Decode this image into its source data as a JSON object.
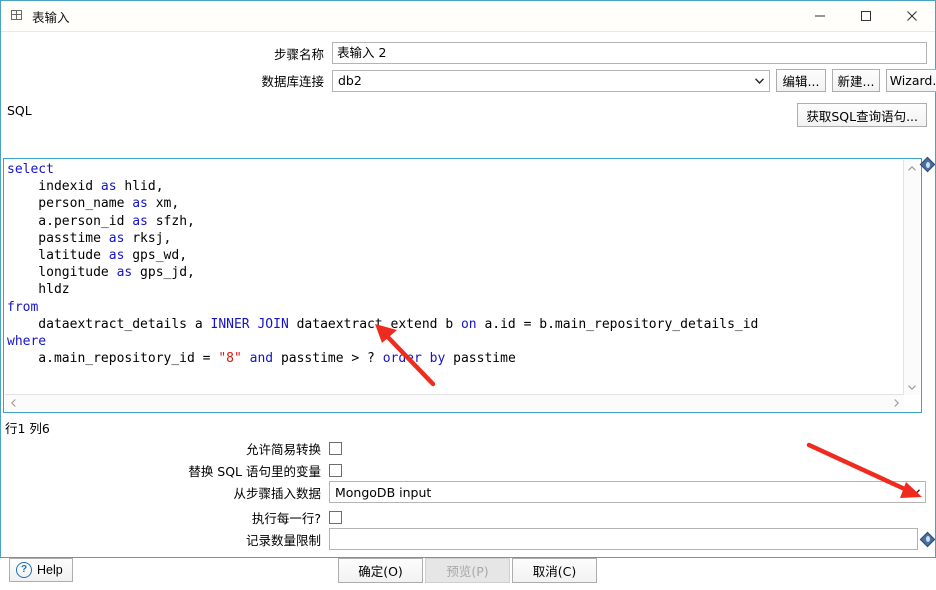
{
  "window": {
    "title": "表输入",
    "icon": "table-input-icon",
    "controls": {
      "minimize": "minimize-icon",
      "maximize": "maximize-icon",
      "close": "close-icon"
    }
  },
  "form": {
    "step_name_label": "步骤名称",
    "step_name_value": "表输入 2",
    "connection_label": "数据库连接",
    "connection_value": "db2",
    "edit_button": "编辑...",
    "new_button": "新建...",
    "wizard_button": "Wizard...",
    "get_sql_button": "获取SQL查询语句..."
  },
  "sql": {
    "label": "SQL",
    "lines": [
      [
        {
          "t": "select",
          "c": "k"
        }
      ],
      [
        {
          "t": "    indexid ",
          "c": ""
        },
        {
          "t": "as",
          "c": "k"
        },
        {
          "t": " hlid,",
          "c": ""
        }
      ],
      [
        {
          "t": "    person_name ",
          "c": ""
        },
        {
          "t": "as",
          "c": "k"
        },
        {
          "t": " xm,",
          "c": ""
        }
      ],
      [
        {
          "t": "    a.person_id ",
          "c": ""
        },
        {
          "t": "as",
          "c": "k"
        },
        {
          "t": " sfzh,",
          "c": ""
        }
      ],
      [
        {
          "t": "    passtime ",
          "c": ""
        },
        {
          "t": "as",
          "c": "k"
        },
        {
          "t": " rksj,",
          "c": ""
        }
      ],
      [
        {
          "t": "    latitude ",
          "c": ""
        },
        {
          "t": "as",
          "c": "k"
        },
        {
          "t": " gps_wd,",
          "c": ""
        }
      ],
      [
        {
          "t": "    longitude ",
          "c": ""
        },
        {
          "t": "as",
          "c": "k"
        },
        {
          "t": " gps_jd,",
          "c": ""
        }
      ],
      [
        {
          "t": "    hldz",
          "c": ""
        }
      ],
      [
        {
          "t": "from",
          "c": "k"
        }
      ],
      [
        {
          "t": "    dataextract_details a ",
          "c": ""
        },
        {
          "t": "INNER JOIN",
          "c": "k"
        },
        {
          "t": " dataextract_extend b ",
          "c": ""
        },
        {
          "t": "on",
          "c": "k"
        },
        {
          "t": " a.id = b.main_repository_details_id",
          "c": ""
        }
      ],
      [
        {
          "t": "where",
          "c": "k"
        }
      ],
      [
        {
          "t": "    a.main_repository_id = ",
          "c": ""
        },
        {
          "t": "\"8\"",
          "c": "s"
        },
        {
          "t": " ",
          "c": ""
        },
        {
          "t": "and",
          "c": "k"
        },
        {
          "t": " passtime > ? ",
          "c": ""
        },
        {
          "t": "order by",
          "c": "k"
        },
        {
          "t": " passtime",
          "c": ""
        }
      ]
    ],
    "status": "行1 列6"
  },
  "options": {
    "allow_simple_transform_label": "允许简易转换",
    "allow_simple_transform_checked": false,
    "replace_variables_label": "替换 SQL 语句里的变量",
    "replace_variables_checked": false,
    "insert_data_from_step_label": "从步骤插入数据",
    "insert_data_from_step_value": "MongoDB input",
    "execute_each_row_label": "执行每一行?",
    "execute_each_row_checked": false,
    "row_limit_label": "记录数量限制",
    "row_limit_value": ""
  },
  "footer": {
    "help_label": "Help",
    "ok_label": "确定(O)",
    "preview_label": "预览(P)",
    "cancel_label": "取消(C)",
    "preview_disabled": true
  },
  "annotations": {
    "arrow_color": "#ef2b1f",
    "arrow_1_target": "sql-parameter-placeholder",
    "arrow_2_target": "insert-data-from-step-dropdown"
  }
}
